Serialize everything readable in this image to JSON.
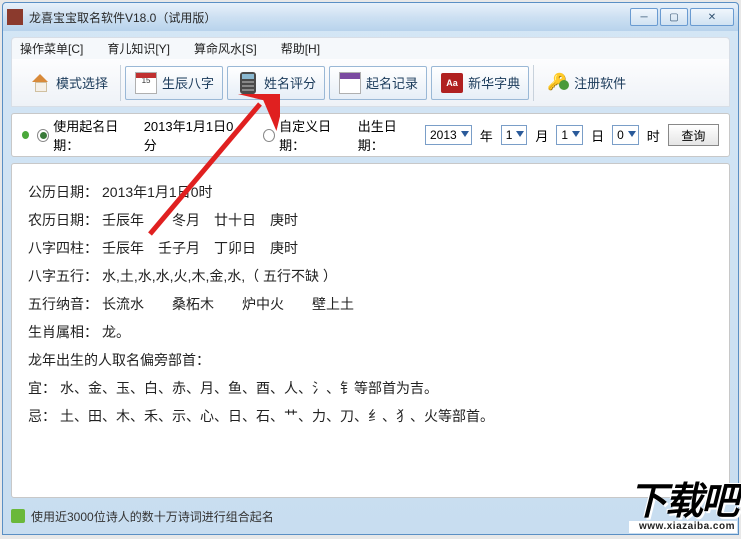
{
  "window": {
    "title": "龙喜宝宝取名软件V18.0（试用版）"
  },
  "menubar": {
    "items": [
      "操作菜单[C]",
      "育儿知识[Y]",
      "算命风水[S]",
      "帮助[H]"
    ]
  },
  "toolbar": {
    "mode_select": "模式选择",
    "birth_eight": "生辰八字",
    "name_score": "姓名评分",
    "name_record": "起名记录",
    "dictionary": "新华字典",
    "register": "注册软件",
    "calendar_day": "15",
    "dict_label": "Aa"
  },
  "datebar": {
    "radio_use_label": "使用起名日期：",
    "use_date_value": "2013年1月1日0分",
    "radio_custom_label": "自定义日期：",
    "birth_label": "出生日期：",
    "year": "2013",
    "year_unit": "年",
    "month": "1",
    "month_unit": "月",
    "day": "1",
    "day_unit": "日",
    "hour": "0",
    "hour_unit": "时",
    "query": "查询"
  },
  "content": {
    "solar_label": "公历日期：",
    "solar_value": "2013年1月1日0时",
    "lunar_label": "农历日期：",
    "lunar_value": "壬辰年　　冬月　廿十日　庚时",
    "bazi_label": "八字四柱：",
    "bazi_value": "壬辰年　壬子月　丁卯日　庚时",
    "wuxing_label": "八字五行：",
    "wuxing_value": "水,土,水,水,火,木,金,水,（ 五行不缺 ）",
    "nayin_label": "五行纳音：",
    "nayin_value": "长流水　　桑柘木　　炉中火　　壁上土",
    "zodiac_label": "生肖属相：",
    "zodiac_value": "龙。",
    "radical_header": "龙年出生的人取名偏旁部首：",
    "good_label": "宜：",
    "good_value": "水、金、玉、白、赤、月、鱼、酉、人、氵、钅等部首为吉。",
    "bad_label": "忌：",
    "bad_value": "土、田、木、禾、示、心、日、石、艹、力、刀、纟、犭、火等部首。"
  },
  "statusbar": {
    "text": "使用近3000位诗人的数十万诗词进行组合起名"
  },
  "watermark": {
    "big": "下载吧",
    "url": "www.xiazaiba.com"
  }
}
